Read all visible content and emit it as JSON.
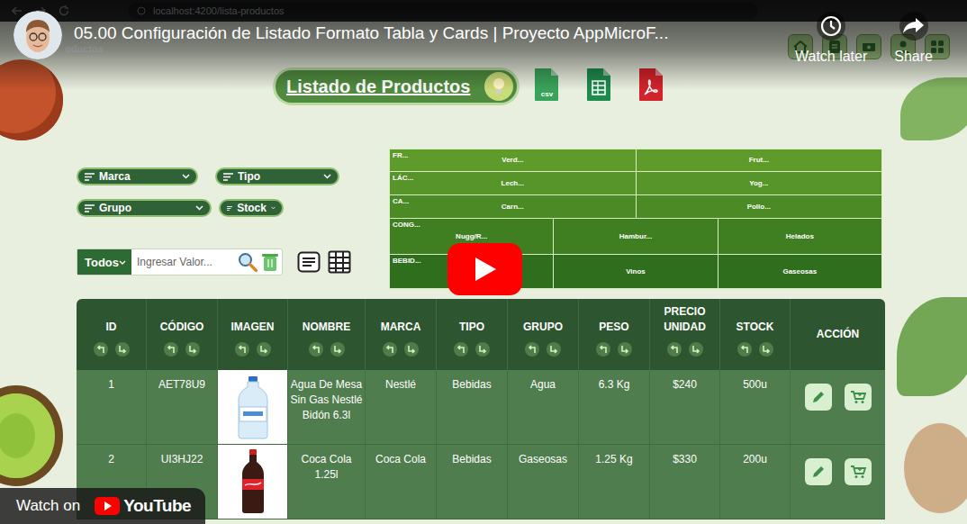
{
  "video": {
    "title": "05.00 Configuración de Listado Formato Tabla y Cards | Proyecto AppMicroF...",
    "watch_later": "Watch later",
    "share": "Share",
    "watch_on": "Watch on",
    "brand": "YouTube"
  },
  "browser": {
    "url": "localhost:4200/lista-productos"
  },
  "nav": {
    "brand": "oductos"
  },
  "page": {
    "title": "Listado de Productos",
    "exports": [
      {
        "kind": "csv",
        "label": "csv"
      },
      {
        "kind": "sheet",
        "label": ""
      },
      {
        "kind": "pdf",
        "label": ""
      }
    ]
  },
  "filters": [
    "Marca",
    "Tipo",
    "Grupo",
    "Stock"
  ],
  "search": {
    "scope": "Todos",
    "placeholder": "Ingresar Valor..."
  },
  "categories": [
    {
      "label": "FR...",
      "items": [
        "Verd...",
        "Frut..."
      ]
    },
    {
      "label": "LÁC...",
      "items": [
        "Lech...",
        "Yog..."
      ]
    },
    {
      "label": "CA...",
      "items": [
        "Carn...",
        "Pollo..."
      ]
    },
    {
      "label": "CONG...",
      "items": [
        "Nugg/R...",
        "Hambur...",
        "Helados"
      ]
    },
    {
      "label": "BEBID...",
      "items": [
        "",
        "Vinos",
        "Gaseosas"
      ]
    }
  ],
  "table": {
    "columns": [
      {
        "label": "ID",
        "sortable": true
      },
      {
        "label": "CÓDIGO",
        "sortable": true
      },
      {
        "label": "IMAGEN",
        "sortable": true
      },
      {
        "label": "NOMBRE",
        "sortable": true
      },
      {
        "label": "MARCA",
        "sortable": true
      },
      {
        "label": "TIPO",
        "sortable": true
      },
      {
        "label": "GRUPO",
        "sortable": true
      },
      {
        "label": "PESO",
        "sortable": true
      },
      {
        "label": "PRECIO UNIDAD",
        "sortable": true
      },
      {
        "label": "STOCK",
        "sortable": true
      },
      {
        "label": "ACCIÓN",
        "sortable": false
      }
    ],
    "rows": [
      {
        "id": "1",
        "code": "AET78U9",
        "image": "water",
        "name": "Agua De Mesa Sin Gas Nestlé Bidón 6.3l",
        "brand": "Nestlé",
        "type": "Bebidas",
        "group": "Agua",
        "weight": "6.3 Kg",
        "price": "$240",
        "stock": "500u"
      },
      {
        "id": "2",
        "code": "UI3HJ22",
        "image": "cola",
        "name": "Coca Cola 1.25l",
        "brand": "Coca Cola",
        "type": "Bebidas",
        "group": "Gaseosas",
        "weight": "1.25 Kg",
        "price": "$330",
        "stock": "200u"
      }
    ]
  }
}
